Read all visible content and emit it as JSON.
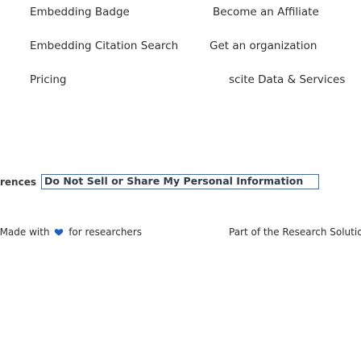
{
  "links": {
    "col1": [
      "Embedding Badge",
      "Embedding Citation Search",
      "Pricing"
    ],
    "col2": [
      "Become an Affiliate",
      "Get an organization",
      "scite Data & Services"
    ]
  },
  "footer": {
    "preferences_label": "Preferences",
    "privacy_button": "Do Not Sell or Share My Personal Information",
    "made_with_prefix": "Made with",
    "made_with_suffix": "for researchers",
    "part_of": "Part of the Research Solutions Family."
  },
  "colors": {
    "heart": "#1f5fbf",
    "button_border": "#2f6fd0"
  }
}
